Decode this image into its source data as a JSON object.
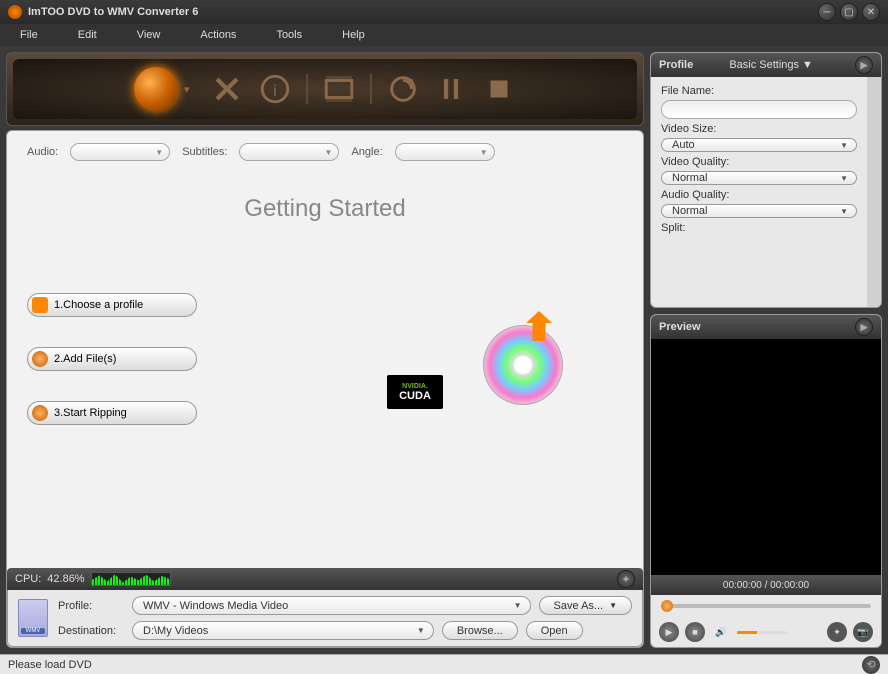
{
  "title": "ImTOO DVD to WMV Converter 6",
  "menu": [
    "File",
    "Edit",
    "View",
    "Actions",
    "Tools",
    "Help"
  ],
  "selectors": {
    "audio": "Audio:",
    "subtitles": "Subtitles:",
    "angle": "Angle:"
  },
  "getting_started": {
    "title": "Getting Started",
    "steps": [
      "1.Choose a profile",
      "2.Add File(s)",
      "3.Start Ripping"
    ]
  },
  "cpu": {
    "label": "CPU:",
    "value": "42.86%"
  },
  "bottom": {
    "profile_label": "Profile:",
    "profile_value": "WMV - Windows Media Video",
    "saveas": "Save As...",
    "dest_label": "Destination:",
    "dest_value": "D:\\My Videos",
    "browse": "Browse...",
    "open": "Open"
  },
  "profile_panel": {
    "title": "Profile",
    "settings": "Basic Settings",
    "fields": {
      "filename_label": "File Name:",
      "filename_value": "",
      "videosize_label": "Video Size:",
      "videosize_value": "Auto",
      "vquality_label": "Video Quality:",
      "vquality_value": "Normal",
      "aquality_label": "Audio Quality:",
      "aquality_value": "Normal",
      "split_label": "Split:"
    }
  },
  "preview": {
    "title": "Preview",
    "time": "00:00:00 / 00:00:00"
  },
  "cuda": {
    "brand": "NVIDIA.",
    "name": "CUDA"
  },
  "status": "Please load DVD"
}
